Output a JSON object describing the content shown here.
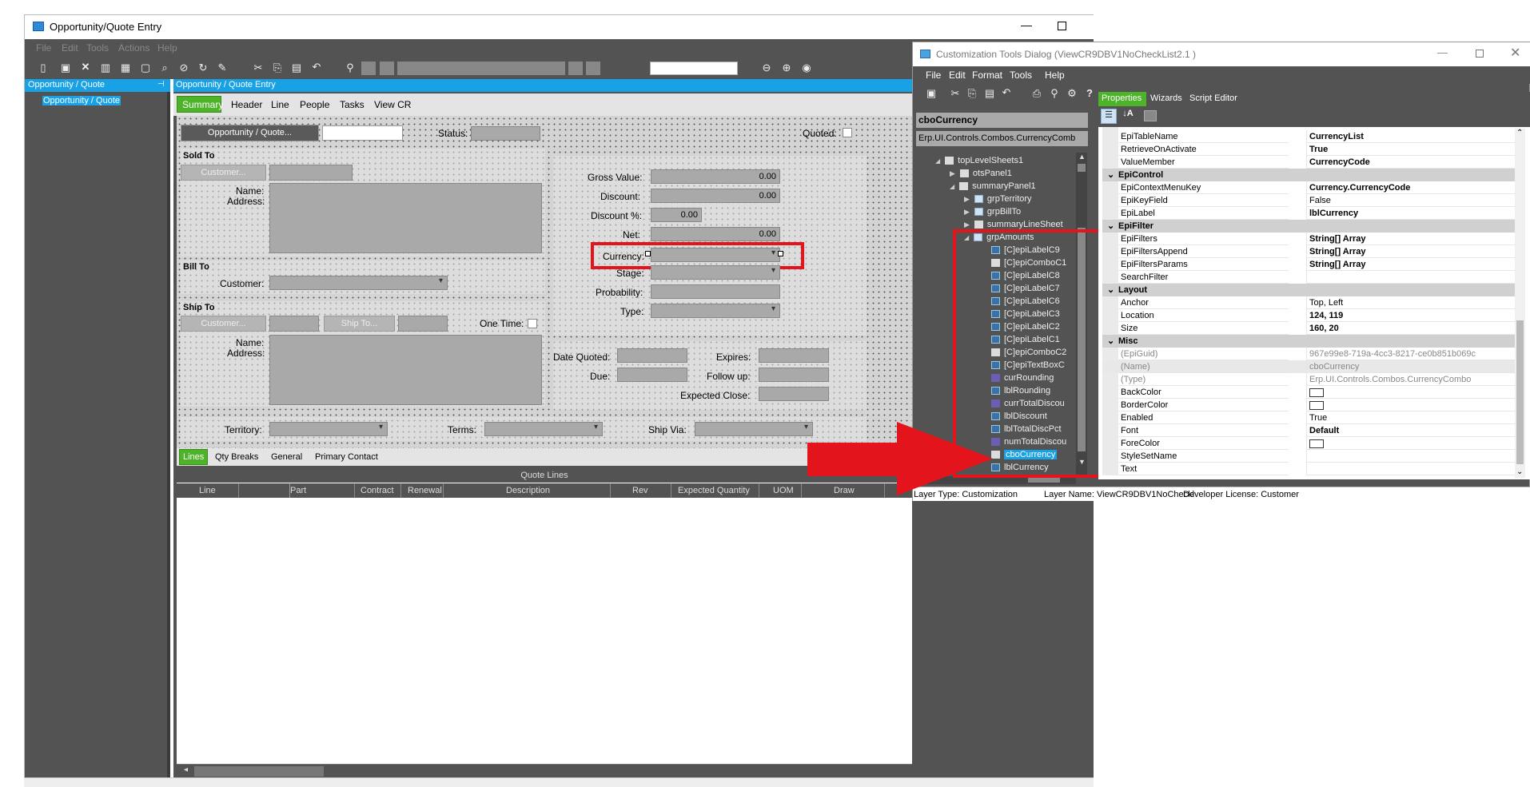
{
  "main_window": {
    "title": "Opportunity/Quote Entry",
    "menu": [
      "File",
      "Edit",
      "Tools",
      "Actions",
      "Help"
    ]
  },
  "left_panel": {
    "header": "Opportunity / Quote",
    "item": "Opportunity / Quote"
  },
  "form": {
    "header": "Opportunity / Quote Entry",
    "tabs": [
      "Summary",
      "Header",
      "Line",
      "People",
      "Tasks",
      "View CR"
    ],
    "opp_button": "Opportunity / Quote...",
    "status_label": "Status:",
    "quoted_label": "Quoted:",
    "sold_to": {
      "title": "Sold To",
      "customer_btn": "Customer...",
      "name_label": "Name:",
      "address_label": "Address:"
    },
    "bill_to": {
      "title": "Bill To",
      "customer_label": "Customer:"
    },
    "ship_to": {
      "title": "Ship To",
      "customer_btn": "Customer...",
      "shipto_btn": "Ship To...",
      "onetime_label": "One Time:",
      "name_label": "Name:",
      "address_label": "Address:"
    },
    "amounts": {
      "gross_label": "Gross Value:",
      "gross_value": "0.00",
      "discount_label": "Discount:",
      "discount_value": "0.00",
      "discpct_label": "Discount %:",
      "discpct_value": "0.00",
      "net_label": "Net:",
      "net_value": "0.00",
      "currency_label": "Currency:",
      "stage_label": "Stage:",
      "probability_label": "Probability:",
      "type_label": "Type:"
    },
    "dates": {
      "date_quoted_label": "Date Quoted:",
      "expires_label": "Expires:",
      "due_label": "Due:",
      "followup_label": "Follow up:",
      "expected_close_label": "Expected Close:"
    },
    "bottom": {
      "territory_label": "Territory:",
      "terms_label": "Terms:",
      "shipvia_label": "Ship Via:"
    },
    "subtabs": [
      "Lines",
      "Qty Breaks",
      "General",
      "Primary Contact"
    ],
    "grid": {
      "title": "Quote Lines",
      "columns": [
        "Line",
        "Part",
        "Contract",
        "Renewal",
        "Description",
        "Rev",
        "Expected Quantity",
        "UOM",
        "Draw"
      ]
    }
  },
  "dialog": {
    "title": "Customization Tools Dialog  (ViewCR9DBV1NoCheckList2.1 )",
    "menu": [
      "File",
      "Edit",
      "Format",
      "Tools",
      "Help"
    ],
    "tabs": [
      "Properties",
      "Wizards",
      "Script Editor"
    ],
    "control_name": "cboCurrency",
    "control_type": "Erp.UI.Controls.Combos.CurrencyComb",
    "tree": [
      "topLevelSheets1",
      "otsPanel1",
      "summaryPanel1",
      "grpTerritory",
      "grpBillTo",
      "summaryLineSheet",
      "grpAmounts",
      "[C]epiLabelC9",
      "[C]epiComboC1",
      "[C]epiLabelC8",
      "[C]epiLabelC7",
      "[C]epiLabelC6",
      "[C]epiLabelC3",
      "[C]epiLabelC2",
      "[C]epiLabelC1",
      "[C]epiComboC2",
      "[C]epiTextBoxC",
      "curRounding",
      "lblRounding",
      "currTotalDiscou",
      "lblDiscount",
      "lblTotalDiscPct",
      "numTotalDiscou",
      "cboCurrency",
      "lblCurrency"
    ],
    "props": {
      "r1": {
        "k": "EpiTableName",
        "v": "CurrencyList"
      },
      "r2": {
        "k": "RetrieveOnActivate",
        "v": "True"
      },
      "r3": {
        "k": "ValueMember",
        "v": "CurrencyCode"
      },
      "c1": "EpiControl",
      "r4": {
        "k": "EpiContextMenuKey",
        "v": "Currency.CurrencyCode"
      },
      "r5": {
        "k": "EpiKeyField",
        "v": "False"
      },
      "r6": {
        "k": "EpiLabel",
        "v": "lblCurrency"
      },
      "c2": "EpiFilter",
      "r7": {
        "k": "EpiFilters",
        "v": "String[] Array"
      },
      "r8": {
        "k": "EpiFiltersAppend",
        "v": "String[] Array"
      },
      "r9": {
        "k": "EpiFiltersParams",
        "v": "String[] Array"
      },
      "r10": {
        "k": "SearchFilter",
        "v": ""
      },
      "c3": "Layout",
      "r11": {
        "k": "Anchor",
        "v": "Top, Left"
      },
      "r12": {
        "k": "Location",
        "v": "124, 119"
      },
      "r13": {
        "k": "Size",
        "v": "160, 20"
      },
      "c4": "Misc",
      "r14": {
        "k": "(EpiGuid)",
        "v": "967e99e8-719a-4cc3-8217-ce0b851b069c"
      },
      "r15": {
        "k": "(Name)",
        "v": "cboCurrency"
      },
      "r16": {
        "k": "(Type)",
        "v": "Erp.UI.Controls.Combos.CurrencyCombo"
      },
      "r17": {
        "k": "BackColor",
        "v": ""
      },
      "r18": {
        "k": "BorderColor",
        "v": ""
      },
      "r19": {
        "k": "Enabled",
        "v": "True"
      },
      "r20": {
        "k": "Font",
        "v": "Default"
      },
      "r21": {
        "k": "ForeColor",
        "v": ""
      },
      "r22": {
        "k": "StyleSetName",
        "v": ""
      },
      "r23": {
        "k": "Text",
        "v": ""
      }
    },
    "status": {
      "layer_type": "Layer Type:  Customization",
      "layer_name": "Layer Name:  ViewCR9DBV1NoCheckl",
      "license": "Developer License:  Customer"
    }
  },
  "colors": {
    "accent_green": "#4db329",
    "header_blue": "#19a1e6",
    "highlight_red": "#e3141b",
    "dark_bg": "#535353"
  }
}
